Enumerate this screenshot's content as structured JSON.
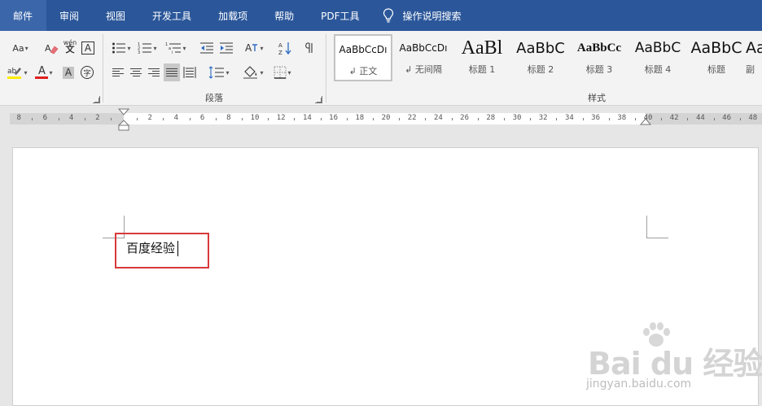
{
  "tabs": [
    "邮件",
    "审阅",
    "视图",
    "开发工具",
    "加载项",
    "帮助",
    "PDF工具"
  ],
  "tell_me": "操作说明搜索",
  "ribbon": {
    "font_group": {
      "change_case": "Aa",
      "phonetic": "wén",
      "char_border": "A",
      "font_color_label": "A",
      "char_shading": "A",
      "enclose_char": "字"
    },
    "paragraph_group": {
      "label": "段落"
    },
    "styles_group": {
      "label": "样式"
    },
    "styles": [
      {
        "preview": "AaBbCcDı",
        "name": "正文"
      },
      {
        "preview": "AaBbCcDı",
        "name": "无间隔"
      },
      {
        "preview": "AaBl",
        "name": "标题 1"
      },
      {
        "preview": "AaBbC",
        "name": "标题 2"
      },
      {
        "preview": "AaBbCc",
        "name": "标题 3"
      },
      {
        "preview": "AaBbC",
        "name": "标题 4"
      },
      {
        "preview": "AaBbC",
        "name": "标题"
      },
      {
        "preview": "Aa",
        "name": "副"
      }
    ]
  },
  "ruler": {
    "left_numbers": [
      "8",
      "6",
      "4",
      "2"
    ],
    "right_numbers": [
      "2",
      "4",
      "6",
      "8",
      "10",
      "12",
      "14",
      "16",
      "18",
      "20",
      "22",
      "24",
      "26",
      "28",
      "30",
      "32",
      "34",
      "36",
      "38",
      "40",
      "42",
      "44",
      "46",
      "48"
    ]
  },
  "document": {
    "text": "百度经验"
  },
  "watermark": {
    "brand": "Bai du 经验",
    "url": "jingyan.baidu.com"
  },
  "colors": {
    "accent": "#2b579a",
    "highlight_box": "#d9393c",
    "font_color": "#e0201e",
    "highlight": "#ffeb00"
  }
}
